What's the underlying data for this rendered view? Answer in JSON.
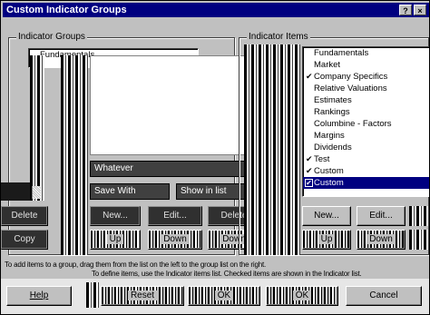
{
  "window": {
    "title": "Custom Indicator Groups",
    "help_glyph": "?",
    "close_glyph": "×"
  },
  "indicator_groups": {
    "label": "Indicator Groups",
    "items": [
      "Fundamentals"
    ],
    "name_field": "Whatever",
    "save_with_label": "Save With",
    "show_label": "Show in list",
    "buttons": {
      "delete": "Delete",
      "copy": "Copy",
      "new": "New...",
      "edit": "Edit...",
      "delete2": "Delete",
      "up": "Up",
      "down": "Down"
    }
  },
  "indicator_items": {
    "label": "Indicator Items",
    "items": [
      {
        "label": "Fundamentals",
        "checked": false,
        "selected": false
      },
      {
        "label": "Market",
        "checked": false,
        "selected": false
      },
      {
        "label": "Company Specifics",
        "checked": true,
        "selected": false
      },
      {
        "label": "Relative Valuations",
        "checked": false,
        "selected": false
      },
      {
        "label": "Estimates",
        "checked": false,
        "selected": false
      },
      {
        "label": "Rankings",
        "checked": false,
        "selected": false
      },
      {
        "label": "Columbine - Factors",
        "checked": false,
        "selected": false
      },
      {
        "label": "Margins",
        "checked": false,
        "selected": false
      },
      {
        "label": "Dividends",
        "checked": false,
        "selected": false
      },
      {
        "label": "Test",
        "checked": true,
        "selected": false
      },
      {
        "label": "Custom",
        "checked": true,
        "selected": false
      },
      {
        "label": "Custom",
        "checked": true,
        "selected": true
      }
    ],
    "buttons": {
      "new": "New...",
      "edit": "Edit...",
      "up": "Up",
      "down": "Down"
    }
  },
  "status": {
    "line1": "To add items to a group, drag them from the list on the left to the group list on the right.",
    "line2": "To define items, use the Indicator items list. Checked items are shown in the Indicator list."
  },
  "footer": {
    "help": "Help",
    "reset": "Reset",
    "ok": "OK",
    "cancel": "Cancel"
  }
}
